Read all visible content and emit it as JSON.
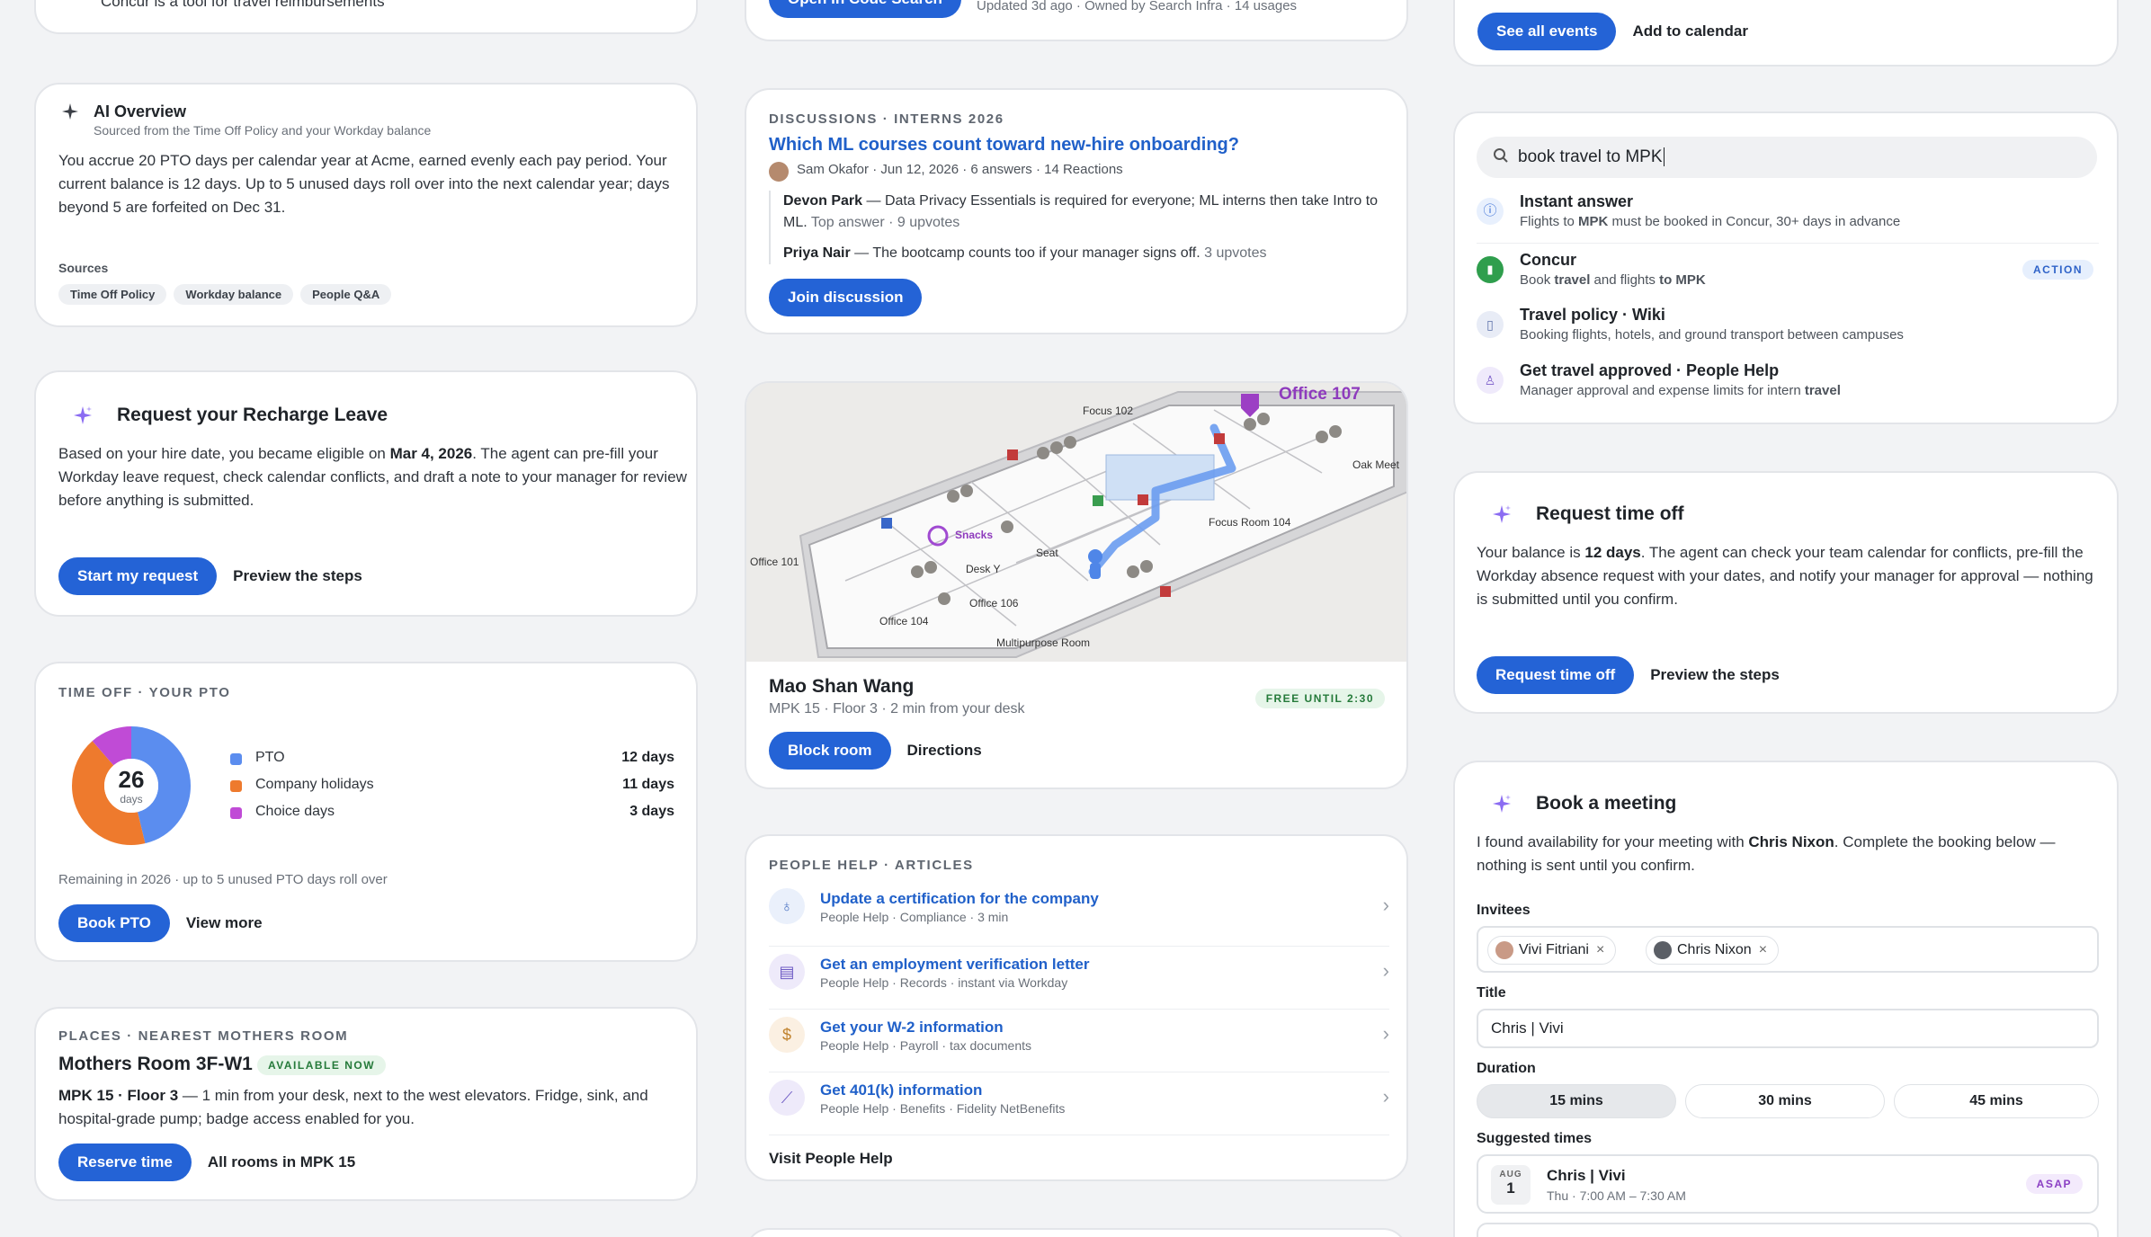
{
  "col1": {
    "top_card": {
      "text": "Concur is a tool for travel reimbursements",
      "concur_bold": "Concur"
    },
    "ai_overview": {
      "title": "AI Overview",
      "subtitle": "Sourced from the Time Off Policy and your Workday balance",
      "body": "You accrue 20 PTO days per calendar year at Acme, earned evenly each pay period. Your current balance is 12 days. Up to 5 unused days roll over into the next calendar year; days beyond 5 are forfeited on Dec 31.",
      "sources_label": "Sources",
      "sources": [
        "Time Off Policy",
        "Workday balance",
        "People Q&A"
      ]
    },
    "recharge": {
      "title": "Request your Recharge Leave",
      "body_pre": "Based on your hire date, you became eligible on ",
      "body_date": "Mar 4, 2026",
      "body_post": ". The agent can pre-fill your Workday leave request, check calendar conflicts, and draft a note to your manager for review before anything is submitted.",
      "primary": "Start my request",
      "secondary": "Preview the steps"
    },
    "pto": {
      "eyebrow": "TIME OFF · YOUR PTO",
      "total": "26",
      "total_unit": "days",
      "legend": [
        {
          "label": "PTO",
          "value": "12 days",
          "color": "#5b8def",
          "amount": 12
        },
        {
          "label": "Company holidays",
          "value": "11 days",
          "color": "#ee7a2d",
          "amount": 11
        },
        {
          "label": "Choice days",
          "value": "3 days",
          "color": "#c04bd6",
          "amount": 3
        }
      ],
      "note": "Remaining in 2026 · up to 5 unused PTO days roll over",
      "primary": "Book PTO",
      "secondary": "View more"
    },
    "mothers_room": {
      "eyebrow": "PLACES · NEAREST MOTHERS ROOM",
      "title": "Mothers Room 3F-W1",
      "badge": "AVAILABLE NOW",
      "body_bold": "MPK 15 · Floor 3",
      "body_rest": " — 1 min from your desk, next to the west elevators. Fridge, sink, and hospital-grade pump; badge access enabled for you.",
      "primary": "Reserve time",
      "secondary": "All rooms in MPK 15"
    }
  },
  "col2": {
    "code_search": {
      "primary": "Open in Code Search",
      "meta": "Updated 3d ago · Owned by Search Infra · 14 usages"
    },
    "discussion": {
      "eyebrow": "DISCUSSIONS · INTERNS 2026",
      "title": "Which ML courses count toward new-hire onboarding?",
      "meta": "Sam Okafor · Jun 12, 2026 · 6 answers · 14 Reactions",
      "answers": [
        {
          "author": "Devon Park",
          "text": " — Data Privacy Essentials is required for everyone; ML interns then take Intro to ML.",
          "meta": " Top answer · 9 upvotes"
        },
        {
          "author": "Priya Nair",
          "text": " — The bootcamp counts too if your manager signs off.",
          "meta": " 3 upvotes"
        }
      ],
      "primary": "Join discussion"
    },
    "map_card": {
      "map_labels": {
        "office107": "Office 107",
        "focus102": "Focus 102",
        "oakmeet": "Oak Meet",
        "focus104": "Focus Room 104",
        "snacks": "Snacks",
        "seat": "Seat",
        "desk": "Desk Y",
        "office101": "Office 101",
        "office106": "Office 106",
        "office104": "Office 104",
        "multipurpose": "Multipurpose Room"
      },
      "room_name": "Mao Shan Wang",
      "room_meta": "MPK 15 · Floor 3 · 2 min from your desk",
      "badge": "FREE UNTIL 2:30",
      "primary": "Block room",
      "secondary": "Directions"
    },
    "people_help": {
      "eyebrow": "PEOPLE HELP · ARTICLES",
      "articles": [
        {
          "title": "Update a certification for the company",
          "meta": "People Help · Compliance · 3 min",
          "icon": "award-icon"
        },
        {
          "title": "Get an employment verification letter",
          "meta": "People Help · Records · instant via Workday",
          "icon": "document-icon"
        },
        {
          "title": "Get your W-2 information",
          "meta": "People Help · Payroll · tax documents",
          "icon": "dollar-icon"
        },
        {
          "title": "Get 401(k) information",
          "meta": "People Help · Benefits · Fidelity NetBenefits",
          "icon": "chart-icon"
        }
      ],
      "footer_link": "Visit People Help"
    }
  },
  "col3": {
    "events": {
      "primary": "See all events",
      "secondary": "Add to calendar"
    },
    "search": {
      "query": "book travel to MPK",
      "results": [
        {
          "title": "Instant answer",
          "sub_pre": "Flights to ",
          "sub_b1": "MPK",
          "sub_mid": " must be booked in Concur, 30+ days in advance",
          "sub_b2": "",
          "sub_post": "",
          "icon": "info-icon"
        },
        {
          "title": "Concur",
          "sub_pre": "Book ",
          "sub_b1": "travel",
          "sub_mid": " and flights ",
          "sub_b2": "to MPK",
          "sub_post": "",
          "icon": "concur-icon",
          "badge": "ACTION"
        },
        {
          "title": "Travel policy · Wiki",
          "sub_pre": "Booking flights, hotels, and ground transport between campuses",
          "sub_b1": "",
          "sub_mid": "",
          "sub_b2": "",
          "sub_post": "",
          "icon": "wiki-icon"
        },
        {
          "title": "Get travel approved · People Help",
          "sub_pre": "Manager approval and expense limits for intern ",
          "sub_b1": "travel",
          "sub_mid": "",
          "sub_b2": "",
          "sub_post": "",
          "icon": "person-icon"
        }
      ]
    },
    "time_off": {
      "title": "Request time off",
      "body_pre": "Your balance is ",
      "body_bold": "12 days",
      "body_post": ". The agent can check your team calendar for conflicts, pre-fill the Workday absence request with your dates, and notify your manager for approval — nothing is submitted until you confirm.",
      "primary": "Request time off",
      "secondary": "Preview the steps"
    },
    "meeting": {
      "title": "Book a meeting",
      "body_pre": "I found availability for your meeting with ",
      "body_bold": "Chris Nixon",
      "body_post": ". Complete the booking below — nothing is sent until you confirm.",
      "invitees_label": "Invitees",
      "invitees": [
        "Vivi Fitriani",
        "Chris Nixon"
      ],
      "title_label": "Title",
      "title_value": "Chris | Vivi",
      "duration_label": "Duration",
      "durations": [
        "15 mins",
        "30 mins",
        "45 mins"
      ],
      "selected_duration": "15 mins",
      "suggested_label": "Suggested times",
      "suggestion": {
        "month": "AUG",
        "day": "1",
        "title": "Chris | Vivi",
        "time": "Thu · 7:00 AM – 7:30 AM",
        "badge": "ASAP"
      }
    }
  }
}
